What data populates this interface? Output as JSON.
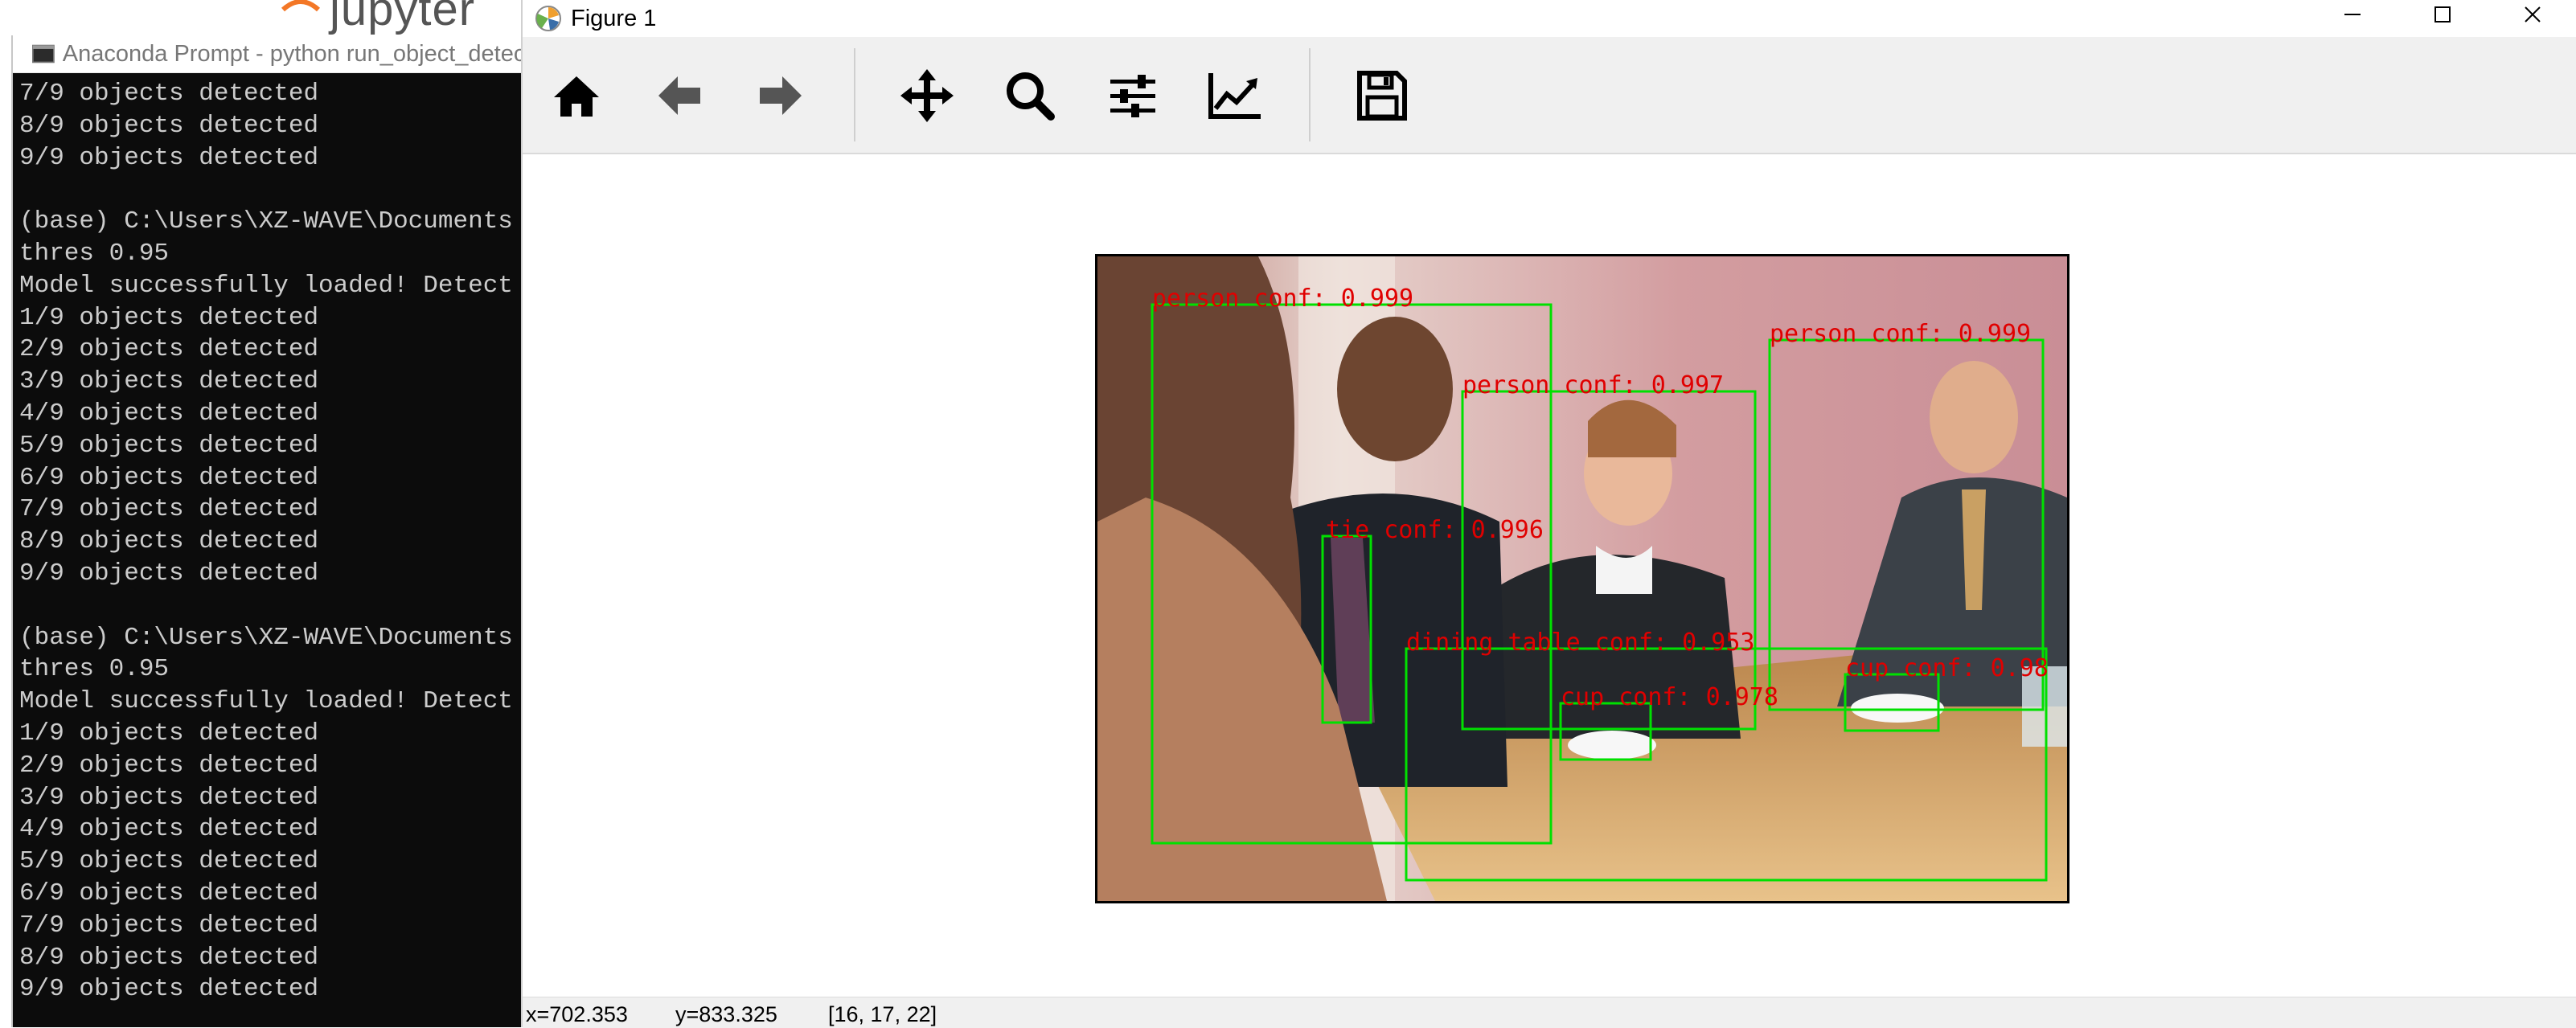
{
  "jupyter": {
    "logo_text": "jupyter"
  },
  "console": {
    "title": "Anaconda Prompt - python  run_object_detection.py",
    "lines": [
      "7/9 objects detected",
      "8/9 objects detected",
      "9/9 objects detected",
      "",
      "(base) C:\\Users\\XZ-WAVE\\Documents",
      "thres 0.95",
      "Model successfully loaded! Detect",
      "1/9 objects detected",
      "2/9 objects detected",
      "3/9 objects detected",
      "4/9 objects detected",
      "5/9 objects detected",
      "6/9 objects detected",
      "7/9 objects detected",
      "8/9 objects detected",
      "9/9 objects detected",
      "",
      "(base) C:\\Users\\XZ-WAVE\\Documents",
      "thres 0.95",
      "Model successfully loaded! Detect",
      "1/9 objects detected",
      "2/9 objects detected",
      "3/9 objects detected",
      "4/9 objects detected",
      "5/9 objects detected",
      "6/9 objects detected",
      "7/9 objects detected",
      "8/9 objects detected",
      "9/9 objects detected"
    ]
  },
  "figure": {
    "title": "Figure 1",
    "toolbar": [
      "home-icon",
      "back-arrow-icon",
      "forward-arrow-icon",
      "pan-icon",
      "zoom-icon",
      "subplots-icon",
      "edit-axis-icon",
      "save-icon"
    ],
    "status": {
      "x": "x=702.353",
      "y": "y=833.325",
      "pixel": "[16, 17, 22]"
    },
    "detection_color": "#00e000",
    "label_color": "#e00000",
    "detections": [
      {
        "label": "person  conf: 0.999"
      },
      {
        "label": "person  conf: 0.997"
      },
      {
        "label": "person  conf: 0.999"
      },
      {
        "label": "tie  conf: 0.996"
      },
      {
        "label": "dining table  conf: 0.953"
      },
      {
        "label": "cup  conf: 0.978"
      },
      {
        "label": "cup  conf: 0.98"
      }
    ]
  }
}
